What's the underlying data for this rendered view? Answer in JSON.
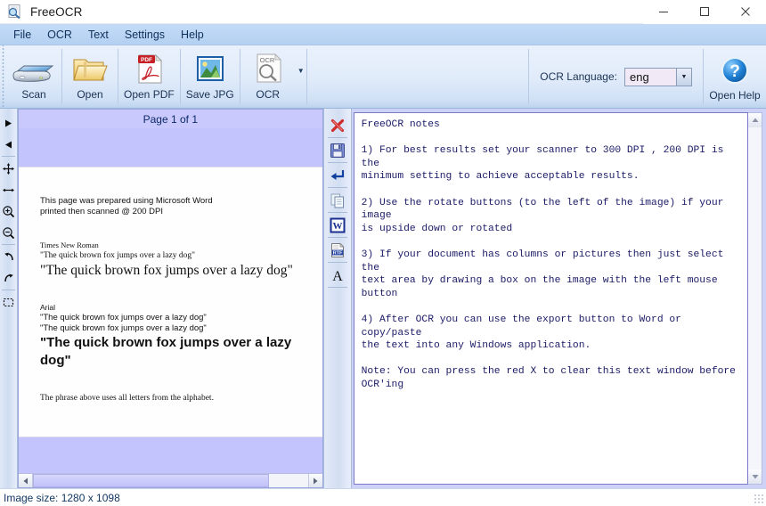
{
  "window": {
    "title": "FreeOCR",
    "icon": "magnifier-document-icon",
    "minimize": "–",
    "maximize": "□",
    "close": "✕"
  },
  "menu": {
    "items": [
      {
        "label": "File"
      },
      {
        "label": "OCR"
      },
      {
        "label": "Text"
      },
      {
        "label": "Settings"
      },
      {
        "label": "Help"
      }
    ]
  },
  "toolbar": {
    "buttons": [
      {
        "label": "Scan",
        "icon": "scanner-icon"
      },
      {
        "label": "Open",
        "icon": "folder-open-icon"
      },
      {
        "label": "Open PDF",
        "icon": "pdf-document-icon"
      },
      {
        "label": "Save JPG",
        "icon": "picture-icon"
      },
      {
        "label": "OCR",
        "icon": "ocr-magnifier-icon"
      }
    ],
    "ocr_dropdown_caret": "▼",
    "language_label": "OCR Language:",
    "language_value": "eng",
    "language_caret": "▼",
    "help": {
      "label": "Open Help",
      "icon": "blue-question-help-icon"
    }
  },
  "image_tools": {
    "buttons": [
      {
        "name": "next-page",
        "icon": "triangle-right-icon",
        "glyph": "►"
      },
      {
        "name": "previous-page",
        "icon": "triangle-left-icon",
        "glyph": "◄"
      },
      {
        "name": "pan",
        "icon": "move-arrows-icon",
        "glyph": "✥"
      },
      {
        "name": "fit-width",
        "icon": "left-right-arrow-icon",
        "glyph": "↔"
      },
      {
        "name": "zoom-in",
        "icon": "magnifier-plus-icon",
        "glyph": "⊕"
      },
      {
        "name": "zoom-out",
        "icon": "magnifier-minus-icon",
        "glyph": "⊖"
      },
      {
        "name": "rotate-left",
        "icon": "rotate-ccw-icon",
        "glyph": "↺"
      },
      {
        "name": "rotate-right",
        "icon": "rotate-cw-icon",
        "glyph": "↻"
      },
      {
        "name": "select-region",
        "icon": "dashed-selection-icon",
        "glyph": "⬚"
      }
    ]
  },
  "text_tools": {
    "buttons": [
      {
        "name": "clear-text",
        "icon": "red-x-icon"
      },
      {
        "name": "save-text",
        "icon": "floppy-save-icon"
      },
      {
        "name": "insert-newline",
        "icon": "enter-arrow-icon"
      },
      {
        "name": "copy-text",
        "icon": "copy-pages-icon"
      },
      {
        "name": "export-word",
        "icon": "word-export-icon"
      },
      {
        "name": "export-rtf",
        "icon": "rtf-export-icon"
      },
      {
        "name": "font-settings",
        "icon": "font-letter-a-icon"
      }
    ]
  },
  "image_panel": {
    "page_label": "Page 1 of 1",
    "document": {
      "intro_line1": "This page was prepared using Microsoft Word",
      "intro_line2": "printed then scanned @ 200 DPI",
      "times_heading": "Times New Roman",
      "times_small": "\"The quick brown fox jumps over a lazy dog\"",
      "times_large": "\"The quick brown fox jumps over a lazy dog\"",
      "arial_heading": "Arial",
      "arial_small1": "\"The quick brown fox jumps over a lazy dog\"",
      "arial_small2": "\"The quick brown fox  jumps over a lazy dog\"",
      "arial_large": "\"The quick brown fox jumps over a lazy dog\"",
      "footer": "The phrase above uses all letters from the alphabet."
    }
  },
  "text_panel": {
    "content": "FreeOCR notes\n\n1) For best results set your scanner to 300 DPI , 200 DPI is the\nminimum setting to achieve acceptable results.\n\n2) Use the rotate buttons (to the left of the image) if your image\nis upside down or rotated\n\n3) If your document has columns or pictures then just select the\ntext area by drawing a box on the image with the left mouse button\n\n4) After OCR you can use the export button to Word or copy/paste\nthe text into any Windows application.\n\nNote: You can press the red X to clear this text window before\nOCR'ing"
  },
  "statusbar": {
    "text": "Image size:  1280 x  1098"
  },
  "colors": {
    "menu_bar": "#b9d5f3",
    "toolbar_top": "#eaf1fc",
    "toolbar_bottom": "#bcd3ef",
    "image_bg": "#c3c3fd",
    "text_panel_bg": "#cfd2f7",
    "text_color": "#1a1a66",
    "accent_blue": "#1a3354",
    "clear_red": "#cc2222"
  }
}
